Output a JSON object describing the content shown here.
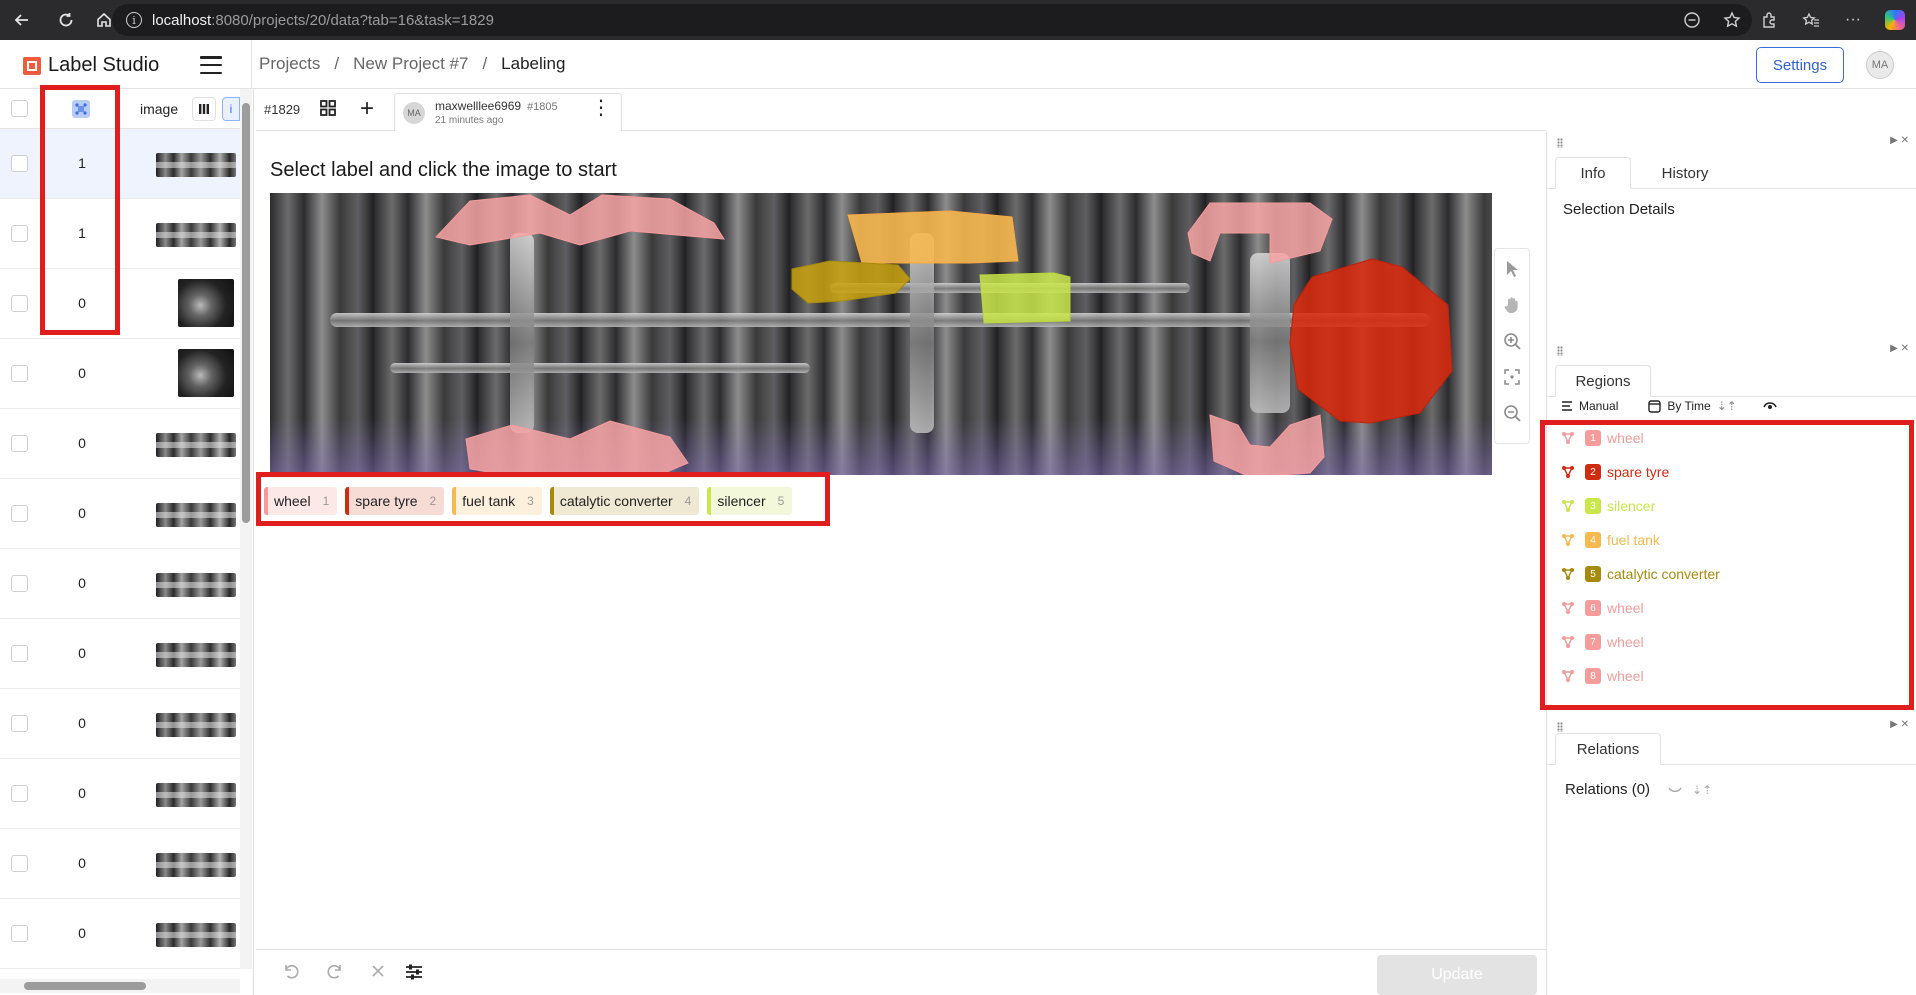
{
  "browser": {
    "url_host": "localhost",
    "url_rest": ":8080/projects/20/data?tab=16&task=1829"
  },
  "app": {
    "name": "Label Studio",
    "breadcrumbs": [
      "Projects",
      "New Project #7",
      "Labeling"
    ],
    "settings_label": "Settings",
    "user_initials": "MA"
  },
  "datatable": {
    "column_image": "image",
    "column_icon_text": "i",
    "rows": [
      {
        "count": "1"
      },
      {
        "count": "1"
      },
      {
        "count": "0"
      },
      {
        "count": "0"
      },
      {
        "count": "0"
      },
      {
        "count": "0"
      },
      {
        "count": "0"
      },
      {
        "count": "0"
      },
      {
        "count": "0"
      },
      {
        "count": "0"
      },
      {
        "count": "0"
      },
      {
        "count": "0"
      }
    ]
  },
  "task": {
    "id": "#1829",
    "annotation": {
      "user": "maxwelllee6969",
      "id": "#1805",
      "time": "21 minutes ago",
      "initials": "MA"
    },
    "instruction": "Select label and click the image to start"
  },
  "labels": [
    {
      "name": "wheel",
      "hotkey": "1",
      "color": "#f59b9b",
      "bg": "#fde8e8"
    },
    {
      "name": "spare tyre",
      "hotkey": "2",
      "color": "#d02c10",
      "bg": "#f7dcd6"
    },
    {
      "name": "fuel tank",
      "hotkey": "3",
      "color": "#f7b84f",
      "bg": "#fdf0dc"
    },
    {
      "name": "catalytic converter",
      "hotkey": "4",
      "color": "#a68a0b",
      "bg": "#efe9d3"
    },
    {
      "name": "silencer",
      "hotkey": "5",
      "color": "#c9e64a",
      "bg": "#f2f8d9"
    }
  ],
  "bottom": {
    "update_label": "Update"
  },
  "info_panel": {
    "tabs": [
      "Info",
      "History"
    ],
    "heading": "Selection Details"
  },
  "regions_panel": {
    "tab": "Regions",
    "sort_manual": "Manual",
    "sort_by": "By Time",
    "regions": [
      {
        "num": "1",
        "label": "wheel",
        "color": "#f59b9b"
      },
      {
        "num": "2",
        "label": "spare tyre",
        "color": "#d02c10"
      },
      {
        "num": "3",
        "label": "silencer",
        "color": "#c9e64a"
      },
      {
        "num": "4",
        "label": "fuel tank",
        "color": "#f7b84f"
      },
      {
        "num": "5",
        "label": "catalytic converter",
        "color": "#a68a0b"
      },
      {
        "num": "6",
        "label": "wheel",
        "color": "#f59b9b"
      },
      {
        "num": "7",
        "label": "wheel",
        "color": "#f59b9b"
      },
      {
        "num": "8",
        "label": "wheel",
        "color": "#f59b9b"
      }
    ]
  },
  "relations_panel": {
    "tab": "Relations",
    "heading": "Relations (0)"
  }
}
